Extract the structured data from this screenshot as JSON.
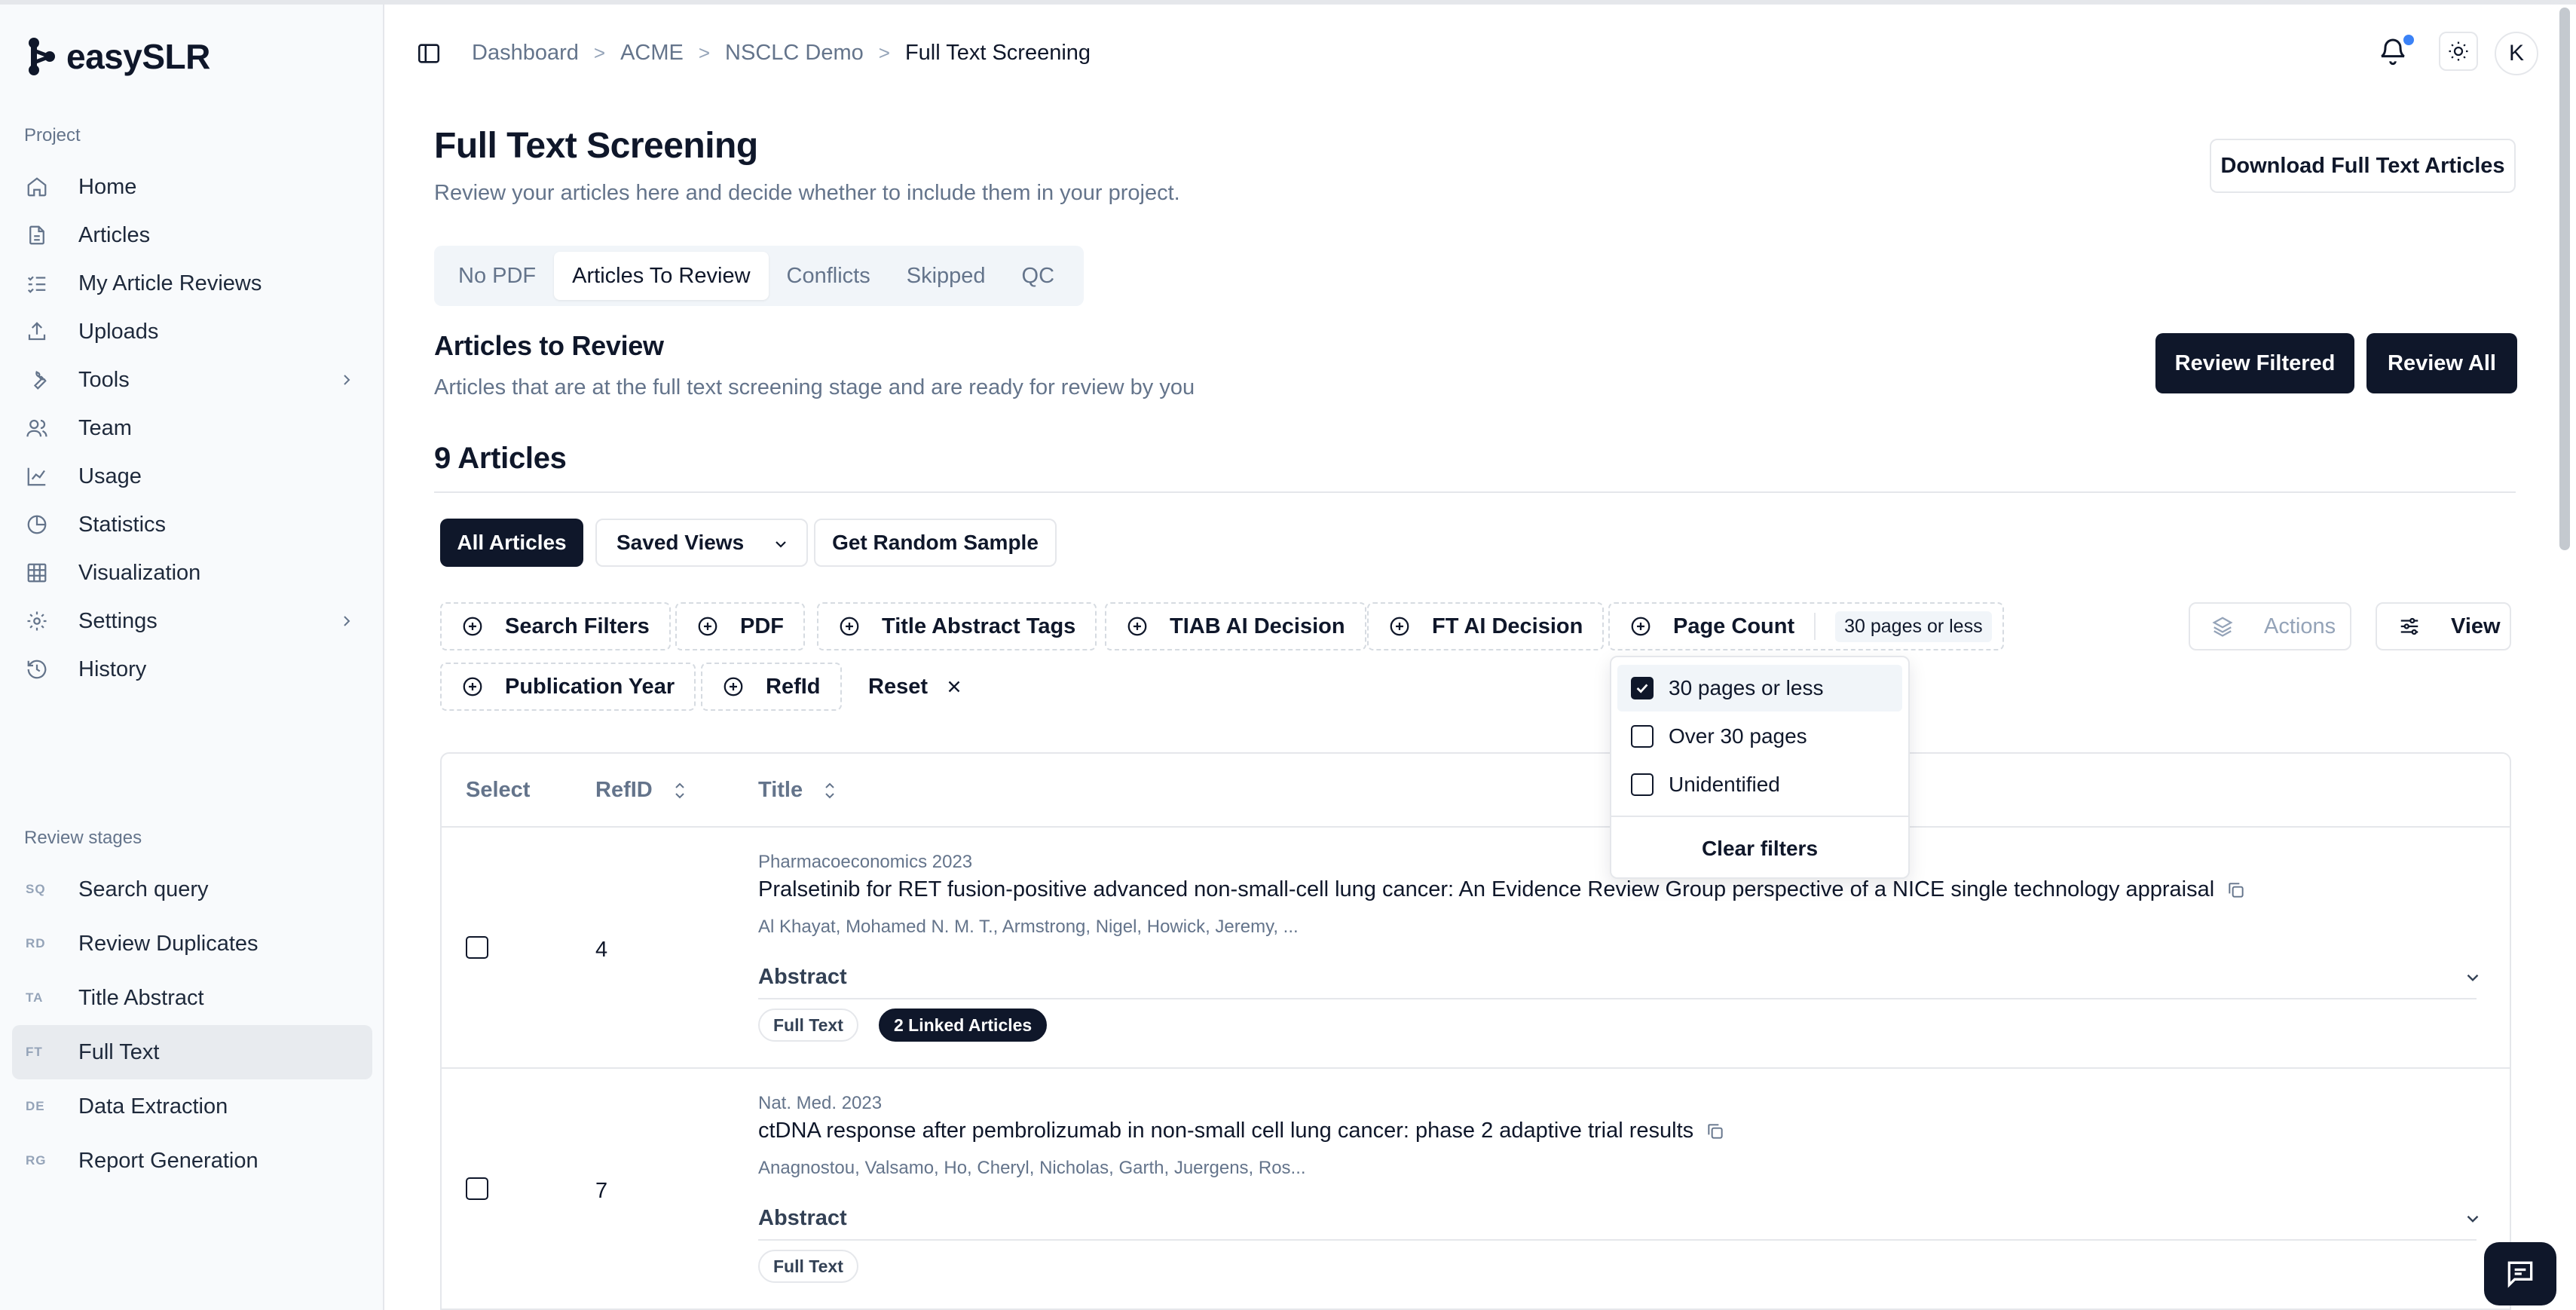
{
  "app": {
    "name": "easySLR"
  },
  "sidebar": {
    "project_label": "Project",
    "items": [
      {
        "label": "Home",
        "icon": "home-icon"
      },
      {
        "label": "Articles",
        "icon": "file-icon"
      },
      {
        "label": "My Article Reviews",
        "icon": "list-check-icon"
      },
      {
        "label": "Uploads",
        "icon": "upload-icon"
      },
      {
        "label": "Tools",
        "icon": "wrench-icon"
      },
      {
        "label": "Team",
        "icon": "users-icon"
      },
      {
        "label": "Usage",
        "icon": "line-chart-icon"
      },
      {
        "label": "Statistics",
        "icon": "pie-chart-icon"
      },
      {
        "label": "Visualization",
        "icon": "grid-icon"
      },
      {
        "label": "Settings",
        "icon": "gear-icon"
      },
      {
        "label": "History",
        "icon": "history-icon"
      }
    ],
    "stages_label": "Review stages",
    "stages": [
      {
        "abbr": "SQ",
        "label": "Search query"
      },
      {
        "abbr": "RD",
        "label": "Review Duplicates"
      },
      {
        "abbr": "TA",
        "label": "Title Abstract"
      },
      {
        "abbr": "FT",
        "label": "Full Text"
      },
      {
        "abbr": "DE",
        "label": "Data Extraction"
      },
      {
        "abbr": "RG",
        "label": "Report Generation"
      }
    ]
  },
  "header": {
    "breadcrumb": [
      "Dashboard",
      "ACME",
      "NSCLC Demo",
      "Full Text Screening"
    ],
    "avatar_initial": "K"
  },
  "main": {
    "title": "Full Text Screening",
    "subtitle": "Review your articles here and decide whether to include them in your project.",
    "download_button": "Download Full Text Articles",
    "tabs": [
      "No PDF",
      "Articles To Review",
      "Conflicts",
      "Skipped",
      "QC"
    ],
    "section_title": "Articles to Review",
    "section_subtitle": "Articles that are at the full text screening stage and are ready for review by you",
    "review_filtered": "Review Filtered",
    "review_all": "Review All",
    "count_title": "9 Articles",
    "view_buttons": {
      "all": "All Articles",
      "saved": "Saved Views",
      "random": "Get Random Sample"
    },
    "filters": {
      "search": "Search Filters",
      "pdf": "PDF",
      "tags": "Title Abstract Tags",
      "tiab": "TIAB AI Decision",
      "ft": "FT AI Decision",
      "page_count": "Page Count",
      "page_count_value": "30 pages or less",
      "pub_year": "Publication Year",
      "refid": "RefId",
      "reset": "Reset",
      "actions": "Actions",
      "view": "View"
    },
    "dropdown": {
      "options": [
        {
          "label": "30 pages or less",
          "checked": true
        },
        {
          "label": "Over 30 pages",
          "checked": false
        },
        {
          "label": "Unidentified",
          "checked": false
        }
      ],
      "clear": "Clear filters"
    },
    "table": {
      "headers": {
        "select": "Select",
        "refid": "RefID",
        "title": "Title"
      },
      "rows": [
        {
          "refid": "4",
          "journal": "Pharmacoeconomics 2023",
          "title": "Pralsetinib for RET fusion-positive advanced non-small-cell lung cancer: An Evidence Review Group perspective of a NICE single technology appraisal",
          "authors": "Al Khayat, Mohamed N. M. T., Armstrong, Nigel, Howick, Jeremy, ...",
          "abstract_label": "Abstract",
          "tags": [
            "Full Text",
            "2 Linked Articles"
          ]
        },
        {
          "refid": "7",
          "journal": "Nat. Med. 2023",
          "title": "ctDNA response after pembrolizumab in non-small cell lung cancer: phase 2 adaptive trial results",
          "authors": "Anagnostou, Valsamo, Ho, Cheryl, Nicholas, Garth, Juergens, Ros...",
          "abstract_label": "Abstract",
          "tags": [
            "Full Text"
          ]
        }
      ]
    }
  },
  "colors": {
    "primary": "#0f172a",
    "muted": "#64748b",
    "border": "#e5e7eb",
    "notification": "#3b82f6"
  }
}
